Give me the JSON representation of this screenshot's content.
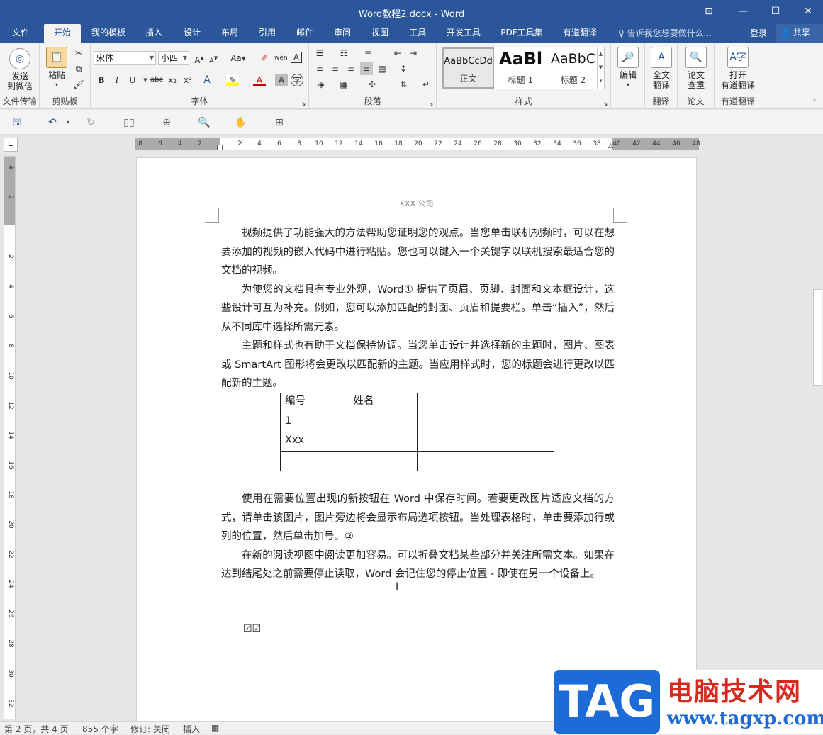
{
  "title": "Word教程2.docx - Word",
  "window_buttons": {
    "ribbon_display": "⊡",
    "minimize": "—",
    "maximize": "☐",
    "close": "✕"
  },
  "tabs": [
    "文件",
    "开始",
    "我的模板",
    "插入",
    "设计",
    "布局",
    "引用",
    "邮件",
    "审阅",
    "视图",
    "工具",
    "开发工具",
    "PDF工具集",
    "有道翻译"
  ],
  "active_tab": "开始",
  "tellme_placeholder": "告诉我您想要做什么...",
  "login_label": "登录",
  "share_label": "共享",
  "ribbon": {
    "file_transfer": {
      "button": "发送到微信",
      "line1": "发送",
      "line2": "到微信",
      "group": "文件传输"
    },
    "clipboard": {
      "paste": "粘贴",
      "group": "剪贴板"
    },
    "font": {
      "name": "宋体",
      "size": "小四",
      "group": "字体",
      "bold": "B",
      "italic": "I",
      "underline": "U",
      "strike": "abc",
      "sub": "x₂",
      "sup": "x²"
    },
    "paragraph": {
      "group": "段落"
    },
    "styles": {
      "group": "样式",
      "items": [
        {
          "sample": "AaBbCcDd",
          "name": "正文"
        },
        {
          "sample": "AaBl",
          "name": "标题 1"
        },
        {
          "sample": "AaBbC",
          "name": "标题 2"
        }
      ]
    },
    "editing": {
      "button": "编辑"
    },
    "translate": {
      "line1": "全文",
      "line2": "翻译",
      "group": "翻译"
    },
    "thesis": {
      "line1": "论文",
      "line2": "查重",
      "group": "论文"
    },
    "youdao": {
      "line1": "打开",
      "line2": "有道翻译",
      "group": "有道翻译"
    }
  },
  "ruler_h": [
    "8",
    "6",
    "4",
    "2",
    "",
    "2",
    "4",
    "6",
    "8",
    "10",
    "12",
    "14",
    "16",
    "18",
    "20",
    "22",
    "24",
    "26",
    "28",
    "30",
    "32",
    "34",
    "36",
    "38",
    "40",
    "42",
    "44",
    "46",
    "48"
  ],
  "ruler_v": [
    "4",
    "2",
    "",
    "2",
    "4",
    "6",
    "8",
    "10",
    "12",
    "14",
    "16",
    "18",
    "20",
    "22",
    "24",
    "26",
    "28",
    "30",
    "32"
  ],
  "document": {
    "header": "XXX 公司",
    "paragraphs": [
      "视频提供了功能强大的方法帮助您证明您的观点。当您单击联机视频时，可以在想要添加的视频的嵌入代码中进行粘贴。您也可以键入一个关键字以联机搜索最适合您的文档的视频。",
      "为使您的文档具有专业外观，Word① 提供了页眉、页脚、封面和文本框设计，这些设计可互为补充。例如，您可以添加匹配的封面、页眉和提要栏。单击“插入”，然后从不同库中选择所需元素。",
      "主题和样式也有助于文档保持协调。当您单击设计并选择新的主题时，图片、图表或 SmartArt 图形将会更改以匹配新的主题。当应用样式时，您的标题会进行更改以匹配新的主题。"
    ],
    "table": [
      [
        "编号",
        "姓名",
        "",
        ""
      ],
      [
        "1",
        "",
        "",
        ""
      ],
      [
        "Xxx",
        "",
        "",
        ""
      ],
      [
        "",
        "",
        "",
        ""
      ]
    ],
    "paragraphs2": [
      "使用在需要位置出现的新按钮在 Word 中保存时间。若要更改图片适应文档的方式，请单击该图片，图片旁边将会显示布局选项按钮。当处理表格时，单击要添加行或列的位置，然后单击加号。②",
      "在新的阅读视图中阅读更加容易。可以折叠文档某些部分并关注所需文本。如果在达到结尾处之前需要停止读取，Word 会记住您的停止位置 - 即使在另一个设备上。"
    ],
    "checkboxes": "☑☑"
  },
  "status": {
    "page": "第 2 页，共 4 页",
    "words": "855 个字",
    "track": "修订: 关闭",
    "mode": "插入"
  },
  "watermark": {
    "tag": "TAG",
    "site_name": "电脑技术网",
    "url": "www.tagxp.com"
  }
}
